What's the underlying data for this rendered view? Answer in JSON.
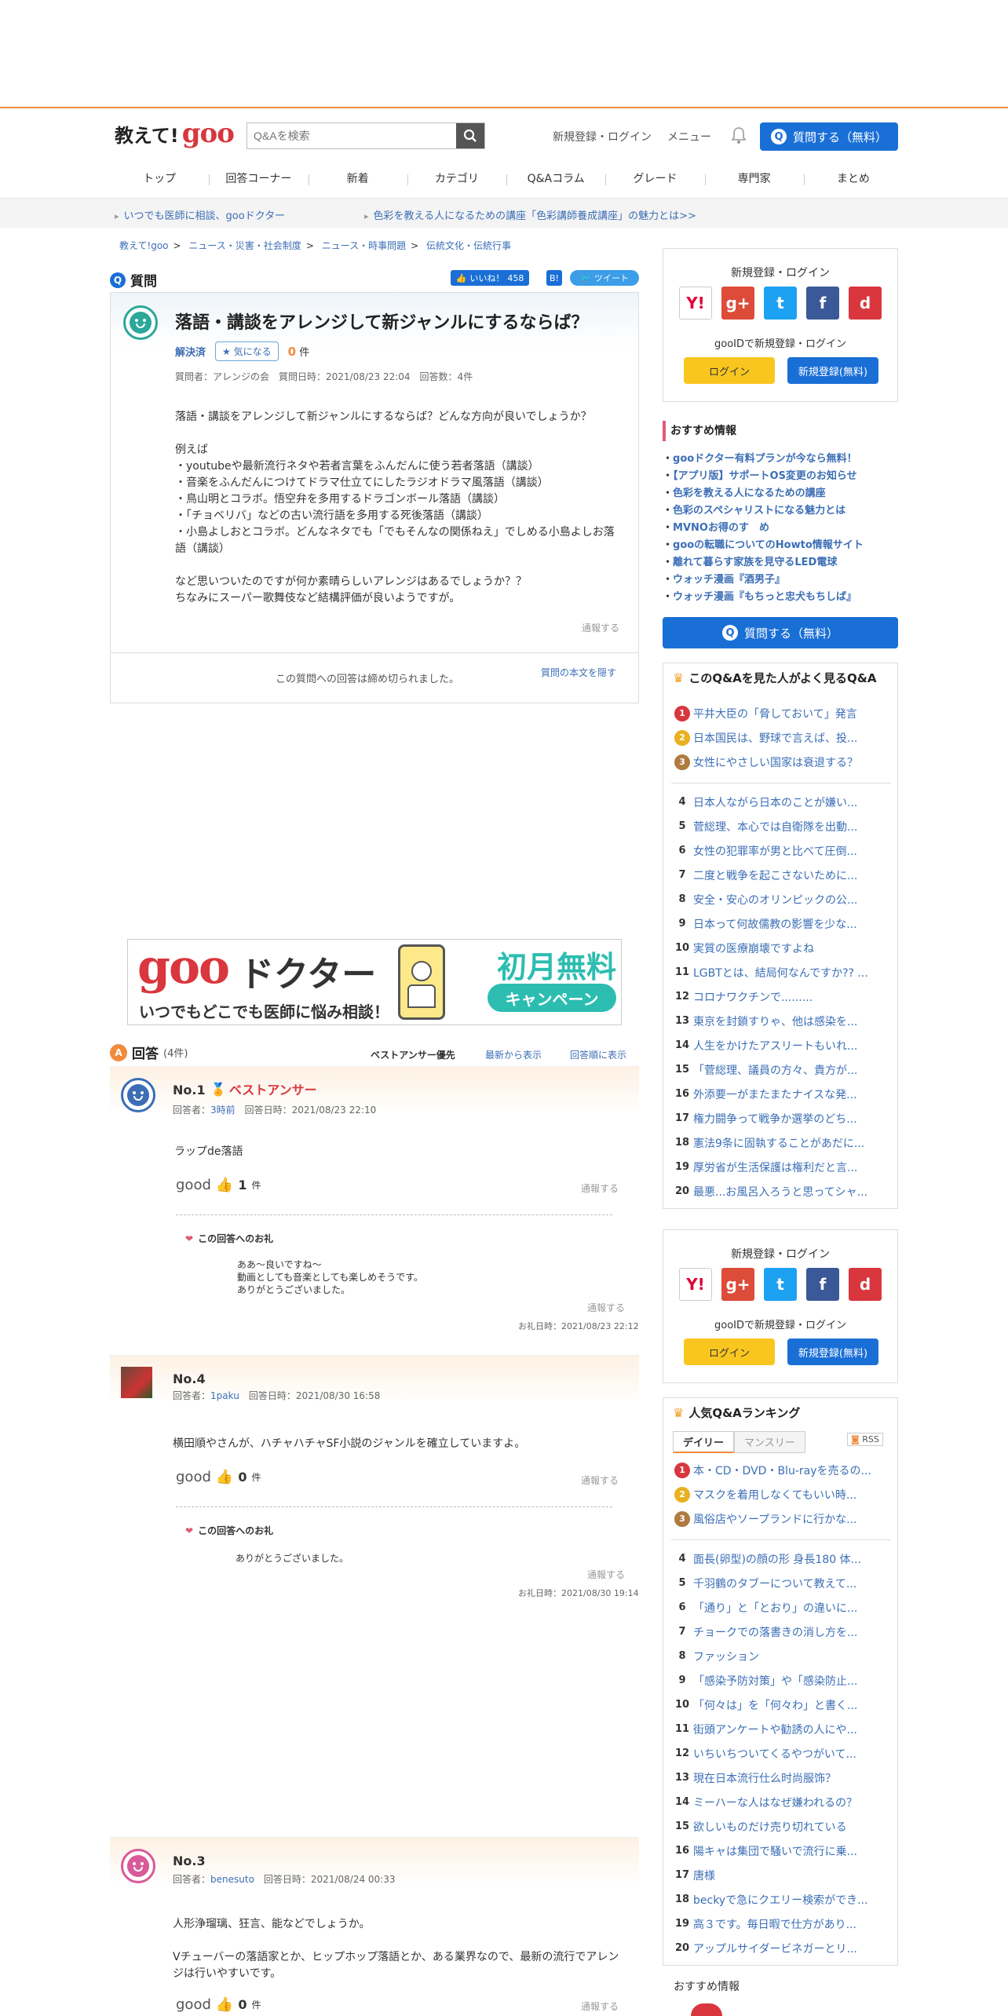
{
  "header": {
    "logo_text": "教えて!",
    "logo_brand": "goo",
    "search_placeholder": "Q&Aを検索",
    "signup_login": "新規登録・ログイン",
    "menu": "メニュー",
    "ask_button": "質問する（無料）"
  },
  "nav": [
    "トップ",
    "回答コーナー",
    "新着",
    "カテゴリ",
    "Q&Aコラム",
    "グレード",
    "専門家",
    "まとめ"
  ],
  "subbar": [
    "いつでも医師に相談、gooドクター",
    "色彩を教える人になるための講座「色彩講師養成講座」の魅力とは>>"
  ],
  "breadcrumb": [
    "教えて!goo",
    "ニュース・災害・社会制度",
    "ニュース・時事問題",
    "伝統文化・伝統行事"
  ],
  "question": {
    "section_label": "質問",
    "like_label": "いいね！",
    "like_count": "458",
    "tweet_label": "ツイート",
    "title": "落語・講談をアレンジして新ジャンルにするならば？",
    "status": "解決済",
    "fav_label": "気になる",
    "count": "0",
    "count_unit": "件",
    "meta": "質問者：アレンジの会　質問日時：2021/08/23 22:04　回答数：4件",
    "body": "落語・講談をアレンジして新ジャンルにするならば？どんな方向が良いでしょうか？\n\n例えば\n・youtubeや最新流行ネタや若者言葉をふんだんに使う若者落語（講談）\n・音楽をふんだんにつけてドラマ仕立てにしたラジオドラマ風落語（講談）\n・鳥山明とコラボ。悟空弁を多用するドラゴンボール落語（講談）\n・「チョベリバ」などの古い流行語を多用する死後落語（講談）\n・小島よしおとコラボ。どんなネタでも「でもそんなの関係ねえ」でしめる小島よしお落語（講談）\n\nなど思いついたのですが何か素晴らしいアレンジはあるでしょうか？？\nちなみにスーパー歌舞伎など結構評価が良いようですが。",
    "report": "通報する",
    "closed_note": "この質問への回答は締め切られました。",
    "hide_body": "質問の本文を隠す"
  },
  "ad": {
    "brand": "goo",
    "title": "ドクター",
    "tagline": "いつでもどこでも医師に悩み相談！",
    "badge1": "初月無料",
    "badge2": "キャンペーン"
  },
  "answers_header": {
    "label": "回答",
    "count": "(4件)",
    "sort": [
      "ベストアンサー優先",
      "最新から表示",
      "回答順に表示"
    ]
  },
  "answers": [
    {
      "no": "No.1",
      "best": "ベストアンサー",
      "meta": "回答者：",
      "user": "3時前",
      "date": "　回答日時：2021/08/23 22:10",
      "text": "ラップde落語",
      "good": "good",
      "good_count": "1",
      "unit": "件",
      "report": "通報する",
      "thanks_label": "この回答へのお礼",
      "thanks_text": "ああ～良いですね～\n動画としても音楽としても楽しめそうです。\nありがとうございました。",
      "thanks_report": "通報する",
      "thanks_date": "お礼日時：2021/08/23 22:12"
    },
    {
      "no": "No.4",
      "meta": "回答者：",
      "user": "1paku",
      "date": "　回答日時：2021/08/30 16:58",
      "text": "横田順やさんが、ハチャハチャSF小説のジャンルを確立していますよ。",
      "good": "good",
      "good_count": "0",
      "unit": "件",
      "report": "通報する",
      "thanks_label": "この回答へのお礼",
      "thanks_text": "ありがとうございました。",
      "thanks_report": "通報する",
      "thanks_date": "お礼日時：2021/08/30 19:14"
    },
    {
      "no": "No.3",
      "meta": "回答者：",
      "user": "benesuto",
      "date": "　回答日時：2021/08/24 00:33",
      "text": "人形浄瑠璃、狂言、能などでしょうか。\n\nVチューバーの落語家とか、ヒップホップ落語とか、ある業界なので、最新の流行でアレンジは行いやすいです。",
      "good": "good",
      "good_count": "0",
      "unit": "件",
      "report": "通報する"
    }
  ],
  "sidebar": {
    "login_title": "新規登録・ログイン",
    "gooid": "gooIDで新規登録・ログイン",
    "login_btn": "ログイン",
    "signup_btn": "新規登録(無料)",
    "social": [
      "Y!",
      "g+",
      "t",
      "f",
      "d"
    ],
    "recommend_title": "おすすめ情報",
    "recommend": [
      "gooドクター有料プランが今なら無料！",
      "【アプリ版】サポートOS変更のお知らせ",
      "色彩を教える人になるための講座",
      "色彩のスペシャリストになる魅力とは",
      "MVNOお得のす　め",
      "gooの転職についてのHowto情報サイト",
      "離れて暮らす家族を見守るLED電球",
      "ウォッチ漫画『酒男子』",
      "ウォッチ漫画『もちっと忠犬もちしば』"
    ],
    "ask_button": "質問する（無料）",
    "related_title": "このQ&Aを見た人がよく見るQ&A",
    "related": [
      "平井大臣の「脅しておいて」発言",
      "日本国民は、野球で言えば、投...",
      "女性にやさしい国家は衰退する？",
      "日本人ながら日本のことが嫌い...",
      "菅総理、本心では自衛隊を出動...",
      "女性の犯罪率が男と比べて圧倒...",
      "二度と戦争を起こさないために...",
      "安全・安心のオリンピックの公...",
      "日本って何故儒教の影響を少な...",
      "実質の医療崩壊ですよね",
      "LGBTとは、結局何なんですか?? ...",
      "コロナワクチンで.........",
      "東京を封鎖すりゃ、他は感染を...",
      "人生をかけたアスリートもいれ...",
      "「菅総理、議員の方々、貴方が...",
      "外添要一がまたまたナイスな発...",
      "権力闘争って戦争か選挙のどち...",
      "憲法9条に固執することがあだに...",
      "厚労省が生活保護は権利だと言...",
      "最悪...お風呂入ろうと思ってシャ..."
    ],
    "ranking_title": "人気Q&Aランキング",
    "ranking_title_hl": "人気",
    "ranking_tabs": [
      "デイリー",
      "マンスリー"
    ],
    "rss": "RSS",
    "ranking": [
      "本・CD・DVD・Blu-rayを売るの...",
      "マスクを着用しなくてもいい時...",
      "風俗店やソープランドに行かな...",
      "面長(卵型)の顔の形 身長180 体...",
      "千羽鶴のタブーについて教えて...",
      "「通り」と「とおり」の違いに...",
      "チョークでの落書きの消し方を...",
      "ファッション",
      "「感染予防対策」や「感染防止...",
      "「何々は」を「何々わ」と書く...",
      "街頭アンケートや勧誘の人にや...",
      "いちいちついてくるやつがいて...",
      "現在日本流行仕么时尚服饰？",
      "ミーハーな人はなぜ嫌われるの？",
      "欲しいものだけ売り切れている",
      "陽キャは集団で騒いで流行に乗...",
      "唐様",
      "beckyで急にクエリー検索ができ...",
      "高３です。毎日暇で仕方があり...",
      "アップルサイダービネガーとリ..."
    ],
    "bottom_recommend": "おすすめ情報"
  },
  "colors": {
    "accent": "#1a6fd6",
    "orange": "#f08a3c",
    "red": "#d9363e",
    "link": "#3b6eb5"
  }
}
